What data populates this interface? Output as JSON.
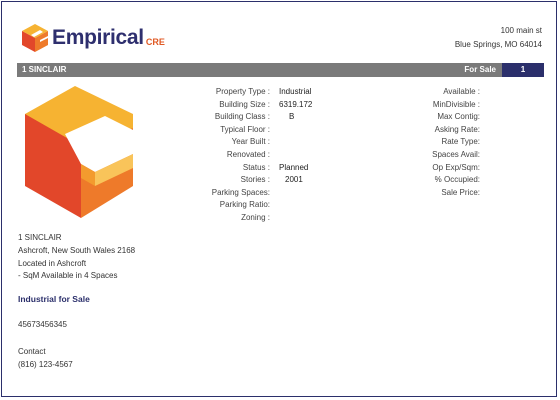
{
  "header": {
    "logo": {
      "word": "Empirical",
      "suffix": "CRE"
    },
    "address_lines": [
      "100 main st",
      "Blue Springs, MO 64014"
    ]
  },
  "bar": {
    "name": "1 SINCLAIR",
    "status": "For Sale",
    "index": "1"
  },
  "hero": {
    "colors": {
      "top": "#f6b332",
      "left": "#e2472a",
      "right": "#ee7a2a",
      "inner": "#f39b2e"
    }
  },
  "details_left": [
    {
      "label": "Property Type :",
      "value": "Industrial"
    },
    {
      "label": "Building Size :",
      "value": "6319.172"
    },
    {
      "label": "Building Class :",
      "value": "B"
    },
    {
      "label": "Typical Floor :",
      "value": ""
    },
    {
      "label": "Year Built :",
      "value": ""
    },
    {
      "label": "Renovated :",
      "value": ""
    },
    {
      "label": "Status :",
      "value": "Planned"
    },
    {
      "label": "Stories :",
      "value": "2001"
    },
    {
      "label": "Parking Spaces:",
      "value": ""
    },
    {
      "label": "Parking Ratio:",
      "value": ""
    },
    {
      "label": "Zoning :",
      "value": ""
    }
  ],
  "details_right": [
    {
      "label": "Available :"
    },
    {
      "label": "MinDivisible :"
    },
    {
      "label": "Max Contig:"
    },
    {
      "label": "Asking Rate:"
    },
    {
      "label": "Rate Type:"
    },
    {
      "label": "Spaces Avail:"
    },
    {
      "label": "Op Exp/Sqm:"
    },
    {
      "label": "% Occupied:"
    },
    {
      "label": "Sale Price:"
    }
  ],
  "info_lines": [
    "1 SINCLAIR",
    "Ashcroft, New South Wales 2168",
    "Located in Ashcroft",
    "- SqM Available in 4 Spaces"
  ],
  "sale_heading": "Industrial for Sale",
  "phone_id": "45673456345",
  "contact": {
    "label": "Contact",
    "phone": "(816) 123-4567"
  }
}
